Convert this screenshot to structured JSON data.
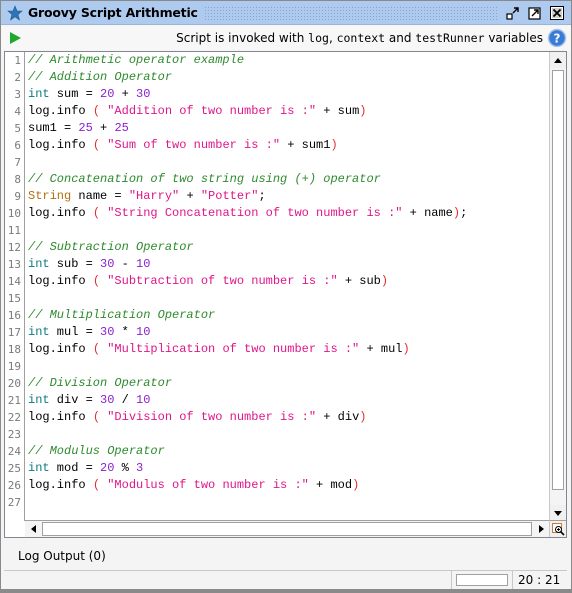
{
  "window": {
    "title": "Groovy Script Arithmetic",
    "colors": {
      "titlebar": "#aecbef",
      "run": "#1fa82e",
      "help": "#3a7bd5"
    }
  },
  "toolbar": {
    "hint_prefix": "Script is invoked with ",
    "var_log": "log",
    "sep1": ", ",
    "var_context": "context",
    "sep2": " and ",
    "var_runner": "testRunner",
    "hint_suffix": " variables"
  },
  "editor": {
    "lines": [
      {
        "n": "1",
        "tokens": [
          [
            "comment",
            "// Arithmetic operator example"
          ]
        ]
      },
      {
        "n": "2",
        "tokens": [
          [
            "comment",
            "// Addition Operator"
          ]
        ]
      },
      {
        "n": "3",
        "tokens": [
          [
            "kw",
            "int"
          ],
          [
            "plain",
            " sum = "
          ],
          [
            "num",
            "20"
          ],
          [
            "plain",
            " + "
          ],
          [
            "num",
            "30"
          ]
        ]
      },
      {
        "n": "4",
        "tokens": [
          [
            "plain",
            "log.info "
          ],
          [
            "paren",
            "("
          ],
          [
            "plain",
            " "
          ],
          [
            "str",
            "\"Addition of two number is :\""
          ],
          [
            "plain",
            " + sum"
          ],
          [
            "paren",
            ")"
          ]
        ]
      },
      {
        "n": "5",
        "tokens": [
          [
            "plain",
            "sum1 = "
          ],
          [
            "num",
            "25"
          ],
          [
            "plain",
            " + "
          ],
          [
            "num",
            "25"
          ]
        ]
      },
      {
        "n": "6",
        "tokens": [
          [
            "plain",
            "log.info "
          ],
          [
            "paren",
            "("
          ],
          [
            "plain",
            " "
          ],
          [
            "str",
            "\"Sum of two number is :\""
          ],
          [
            "plain",
            " + sum1"
          ],
          [
            "paren",
            ")"
          ]
        ]
      },
      {
        "n": "7",
        "tokens": []
      },
      {
        "n": "8",
        "tokens": [
          [
            "comment",
            "// Concatenation of two string using (+) operator"
          ]
        ]
      },
      {
        "n": "9",
        "tokens": [
          [
            "type",
            "String"
          ],
          [
            "plain",
            " name = "
          ],
          [
            "str",
            "\"Harry\""
          ],
          [
            "plain",
            " + "
          ],
          [
            "str",
            "\"Potter\""
          ],
          [
            "plain",
            ";"
          ]
        ]
      },
      {
        "n": "10",
        "tokens": [
          [
            "plain",
            "log.info "
          ],
          [
            "paren",
            "("
          ],
          [
            "plain",
            " "
          ],
          [
            "str",
            "\"String Concatenation of two number is :\""
          ],
          [
            "plain",
            " + name"
          ],
          [
            "paren",
            ")"
          ],
          [
            "plain",
            ";"
          ]
        ]
      },
      {
        "n": "11",
        "tokens": []
      },
      {
        "n": "12",
        "tokens": [
          [
            "comment",
            "// Subtraction Operator"
          ]
        ]
      },
      {
        "n": "13",
        "tokens": [
          [
            "kw",
            "int"
          ],
          [
            "plain",
            " sub = "
          ],
          [
            "num",
            "30"
          ],
          [
            "plain",
            " - "
          ],
          [
            "num",
            "10"
          ]
        ]
      },
      {
        "n": "14",
        "tokens": [
          [
            "plain",
            "log.info "
          ],
          [
            "paren",
            "("
          ],
          [
            "plain",
            " "
          ],
          [
            "str",
            "\"Subtraction of two number is :\""
          ],
          [
            "plain",
            " + sub"
          ],
          [
            "paren",
            ")"
          ]
        ]
      },
      {
        "n": "15",
        "tokens": []
      },
      {
        "n": "16",
        "tokens": [
          [
            "comment",
            "// Multiplication Operator"
          ]
        ]
      },
      {
        "n": "17",
        "tokens": [
          [
            "kw",
            "int"
          ],
          [
            "plain",
            " mul = "
          ],
          [
            "num",
            "30"
          ],
          [
            "plain",
            " * "
          ],
          [
            "num",
            "10"
          ]
        ]
      },
      {
        "n": "18",
        "tokens": [
          [
            "plain",
            "log.info "
          ],
          [
            "paren",
            "("
          ],
          [
            "plain",
            " "
          ],
          [
            "str",
            "\"Multiplication of two number is :\""
          ],
          [
            "plain",
            " + mul"
          ],
          [
            "paren",
            ")"
          ]
        ]
      },
      {
        "n": "19",
        "tokens": []
      },
      {
        "n": "20",
        "tokens": [
          [
            "comment",
            "// Division Operator"
          ]
        ]
      },
      {
        "n": "21",
        "tokens": [
          [
            "kw",
            "int"
          ],
          [
            "plain",
            " div = "
          ],
          [
            "num",
            "30"
          ],
          [
            "plain",
            " / "
          ],
          [
            "num",
            "10"
          ]
        ]
      },
      {
        "n": "22",
        "tokens": [
          [
            "plain",
            "log.info "
          ],
          [
            "paren",
            "("
          ],
          [
            "plain",
            " "
          ],
          [
            "str",
            "\"Division of two number is :\""
          ],
          [
            "plain",
            " + div"
          ],
          [
            "paren",
            ")"
          ]
        ]
      },
      {
        "n": "23",
        "tokens": []
      },
      {
        "n": "24",
        "tokens": [
          [
            "comment",
            "// Modulus Operator"
          ]
        ]
      },
      {
        "n": "25",
        "tokens": [
          [
            "kw",
            "int"
          ],
          [
            "plain",
            " mod = "
          ],
          [
            "num",
            "20"
          ],
          [
            "plain",
            " % "
          ],
          [
            "num",
            "3"
          ]
        ]
      },
      {
        "n": "26",
        "tokens": [
          [
            "plain",
            "log.info "
          ],
          [
            "paren",
            "("
          ],
          [
            "plain",
            " "
          ],
          [
            "str",
            "\"Modulus of two number is :\""
          ],
          [
            "plain",
            " + mod"
          ],
          [
            "paren",
            ")"
          ]
        ]
      },
      {
        "n": "27",
        "tokens": []
      }
    ]
  },
  "log": {
    "tab_label": "Log Output (0)"
  },
  "status": {
    "cursor_position": "20 : 21"
  },
  "icons": {
    "title": "star-icon",
    "detach": "detach-icon",
    "maximize": "maximize-icon",
    "close": "close-icon",
    "run": "run-icon",
    "help": "help-icon",
    "zoom": "zoom-icon"
  }
}
